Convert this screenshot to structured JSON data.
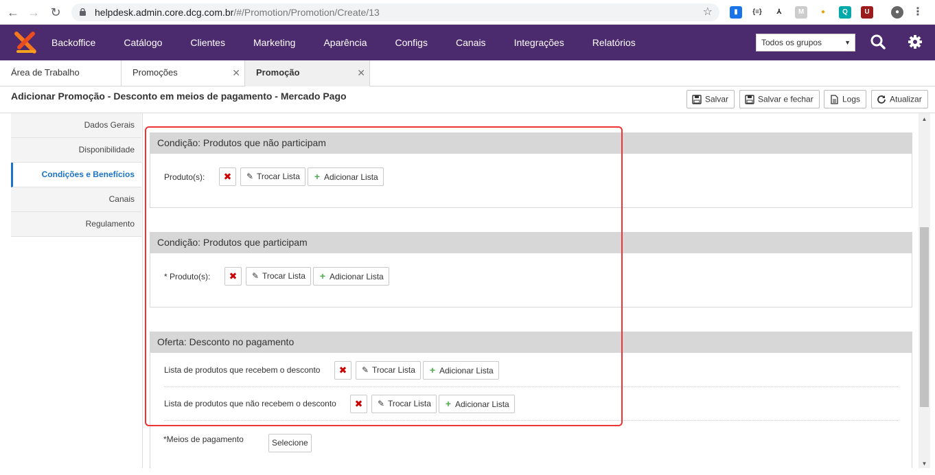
{
  "browser": {
    "url_host": "helpdesk.admin.core.dcg.com.br",
    "url_path": "/#/Promotion/Promotion/Create/13"
  },
  "app": {
    "menu": [
      "Backoffice",
      "Catálogo",
      "Clientes",
      "Marketing",
      "Aparência",
      "Configs",
      "Canais",
      "Integrações",
      "Relatórios"
    ],
    "group_select": "Todos os grupos",
    "accent_color": "#4b2a6e"
  },
  "tabs": [
    {
      "label": "Área de Trabalho"
    },
    {
      "label": "Promoções"
    },
    {
      "label": "Promoção"
    }
  ],
  "page": {
    "title": "Adicionar Promoção - Desconto em meios de pagamento - Mercado Pago",
    "actions": {
      "save": "Salvar",
      "save_close": "Salvar e fechar",
      "logs": "Logs",
      "refresh": "Atualizar"
    }
  },
  "sidenav": [
    "Dados Gerais",
    "Disponibilidade",
    "Condições e Benefícios",
    "Canais",
    "Regulamento"
  ],
  "sections": [
    {
      "title": "Condição: Produtos que não participam",
      "rows": [
        {
          "label": "Produto(s):"
        }
      ]
    },
    {
      "title": "Condição: Produtos que participam",
      "rows": [
        {
          "label": "* Produto(s):"
        }
      ]
    },
    {
      "title": "Oferta: Desconto no pagamento",
      "rows": [
        {
          "label": "Lista de produtos que recebem o desconto"
        },
        {
          "label": "Lista de produtos que não recebem o desconto"
        }
      ]
    }
  ],
  "buttons": {
    "swap": "Trocar Lista",
    "add": "Adicionar Lista"
  },
  "payment": {
    "label": "*Meios de pagamento",
    "select": "Selecione"
  }
}
